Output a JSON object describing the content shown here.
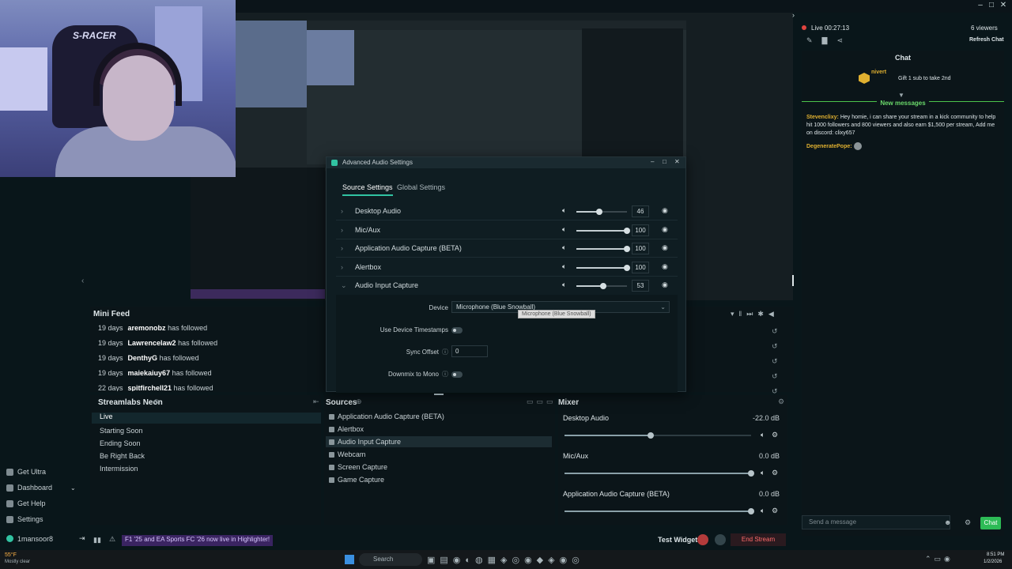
{
  "webcam": {
    "chair_text": "S-RACER"
  },
  "left_nav": {
    "items": [
      {
        "label": "Get Ultra",
        "icon": "ultra-icon"
      },
      {
        "label": "Dashboard",
        "icon": "dashboard-icon"
      },
      {
        "label": "Get Help",
        "icon": "help-icon"
      },
      {
        "label": "Settings",
        "icon": "gear-icon"
      },
      {
        "label": "1mansoor8",
        "icon": "user-icon"
      }
    ]
  },
  "mini_feed": {
    "title": "Mini Feed",
    "rows": [
      {
        "time": "19 days",
        "user": "aremonobz",
        "action": "has followed"
      },
      {
        "time": "19 days",
        "user": "Lawrencelaw2",
        "action": "has followed"
      },
      {
        "time": "19 days",
        "user": "DenthyG",
        "action": "has followed"
      },
      {
        "time": "19 days",
        "user": "maiekaiuy67",
        "action": "has followed"
      },
      {
        "time": "22 days",
        "user": "spitfirchell21",
        "action": "has followed"
      }
    ]
  },
  "scenes": {
    "title": "Streamlabs Neon",
    "items": [
      "Live",
      "Starting Soon",
      "Ending Soon",
      "Be Right Back",
      "Intermission"
    ]
  },
  "sources": {
    "title": "Sources",
    "items": [
      "Application Audio Capture (BETA)",
      "Alertbox",
      "Audio Input Capture",
      "Webcam",
      "Screen Capture",
      "Game Capture"
    ]
  },
  "mixer": {
    "title": "Mixer",
    "channels": [
      {
        "name": "Desktop Audio",
        "db": "-22.0 dB",
        "level": 0.46
      },
      {
        "name": "Mic/Aux",
        "db": "0.0 dB",
        "level": 1.0
      },
      {
        "name": "Application Audio Capture (BETA)",
        "db": "0.0 dB",
        "level": 1.0
      }
    ]
  },
  "bottom_bar": {
    "notification": "F1 '25 and EA Sports FC '26 now live in Highlighter!",
    "test_widgets": "Test Widgets",
    "end_stream": "End Stream"
  },
  "right_panel": {
    "live_time": "Live 00:27:13",
    "viewers": "6 viewers",
    "refresh": "Refresh Chat",
    "chat_title": "Chat",
    "gift_user": "nivert",
    "gift_text": "Gift 1 sub to take 2nd",
    "new_messages": "New messages",
    "messages": [
      {
        "user": "Stevenclixy:",
        "text": "Hey homie, i can share your stream in a kick community to help hit 1000 followers and 800 viewers and also earn $1,500 per stream, Add me on discord: clixy657"
      },
      {
        "user": "DegeneratePope:",
        "text": ""
      }
    ],
    "input_placeholder": "Send a message",
    "chat_button": "Chat"
  },
  "dialog": {
    "title": "Advanced Audio Settings",
    "tabs": [
      "Source Settings",
      "Global Settings"
    ],
    "rows": [
      {
        "name": "Desktop Audio",
        "value": "46",
        "level": 0.46
      },
      {
        "name": "Mic/Aux",
        "value": "100",
        "level": 1.0
      },
      {
        "name": "Application Audio Capture (BETA)",
        "value": "100",
        "level": 1.0
      },
      {
        "name": "Alertbox",
        "value": "100",
        "level": 1.0
      },
      {
        "name": "Audio Input Capture",
        "value": "53",
        "level": 0.53
      }
    ],
    "device_label": "Device",
    "device_value": "Microphone (Blue Snowball)",
    "tooltip": "Microphone (Blue Snowball)",
    "timestamps_label": "Use Device Timestamps",
    "sync_label": "Sync Offset",
    "sync_value": "0",
    "downmix_label": "Downmix to Mono"
  },
  "taskbar": {
    "search": "Search",
    "time": "8:51 PM",
    "date": "1/2/2026",
    "weather": "55°F",
    "weather_sub": "Mostly clear"
  }
}
